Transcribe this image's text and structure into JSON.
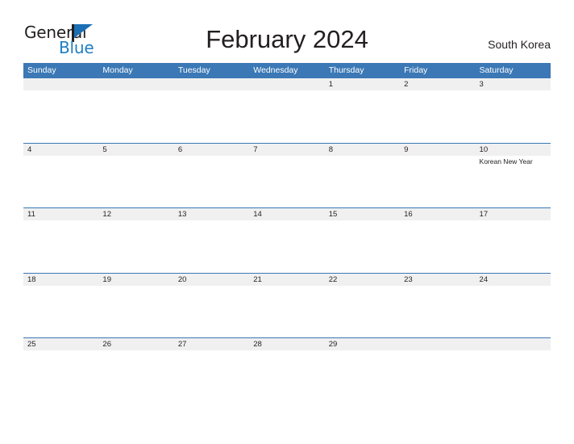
{
  "brand": {
    "word_one": "General",
    "word_two": "Blue",
    "flag_icon": "flag-icon",
    "accent_color": "#1a6fb5",
    "text_color": "#231f20"
  },
  "header": {
    "title": "February 2024",
    "country": "South Korea"
  },
  "calendar": {
    "header_bg": "#3b78b5",
    "band_bg": "#f0f0f0",
    "weekdays": [
      "Sunday",
      "Monday",
      "Tuesday",
      "Wednesday",
      "Thursday",
      "Friday",
      "Saturday"
    ],
    "weeks": [
      [
        {
          "day": ""
        },
        {
          "day": ""
        },
        {
          "day": ""
        },
        {
          "day": ""
        },
        {
          "day": "1"
        },
        {
          "day": "2"
        },
        {
          "day": "3"
        }
      ],
      [
        {
          "day": "4"
        },
        {
          "day": "5"
        },
        {
          "day": "6"
        },
        {
          "day": "7"
        },
        {
          "day": "8"
        },
        {
          "day": "9"
        },
        {
          "day": "10",
          "event": "Korean New Year"
        }
      ],
      [
        {
          "day": "11"
        },
        {
          "day": "12"
        },
        {
          "day": "13"
        },
        {
          "day": "14"
        },
        {
          "day": "15"
        },
        {
          "day": "16"
        },
        {
          "day": "17"
        }
      ],
      [
        {
          "day": "18"
        },
        {
          "day": "19"
        },
        {
          "day": "20"
        },
        {
          "day": "21"
        },
        {
          "day": "22"
        },
        {
          "day": "23"
        },
        {
          "day": "24"
        }
      ],
      [
        {
          "day": "25"
        },
        {
          "day": "26"
        },
        {
          "day": "27"
        },
        {
          "day": "28"
        },
        {
          "day": "29"
        },
        {
          "day": ""
        },
        {
          "day": ""
        }
      ]
    ]
  }
}
